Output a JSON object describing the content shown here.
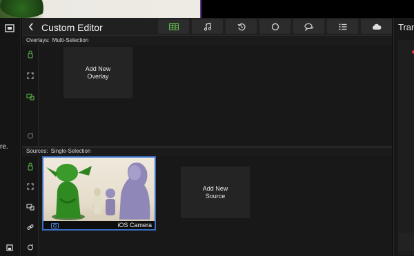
{
  "editor": {
    "title": "Custom Editor"
  },
  "tabs": [
    {
      "name": "grid",
      "active": true
    },
    {
      "name": "music",
      "active": false
    },
    {
      "name": "history",
      "active": false
    },
    {
      "name": "circle",
      "active": false
    },
    {
      "name": "chat",
      "active": false
    },
    {
      "name": "list",
      "active": false
    },
    {
      "name": "cloud",
      "active": false
    }
  ],
  "overlays": {
    "label_prefix": "Overlays:",
    "label_mode": "Multi-Selection",
    "add_tile": "Add New\nOverlay"
  },
  "sources": {
    "label_prefix": "Sources:",
    "label_mode": "Single-Selection",
    "add_tile": "Add New\nSource",
    "items": [
      {
        "name": "iOS Camera",
        "selected": true,
        "icon": "camera-icon"
      }
    ]
  },
  "left_edge": {
    "ellipsis": "re."
  },
  "right_panel": {
    "title": "Tran"
  },
  "colors": {
    "accent_green": "#5fbf4a",
    "selection_blue": "#3a6fc4",
    "record_red": "#d43a3a"
  }
}
